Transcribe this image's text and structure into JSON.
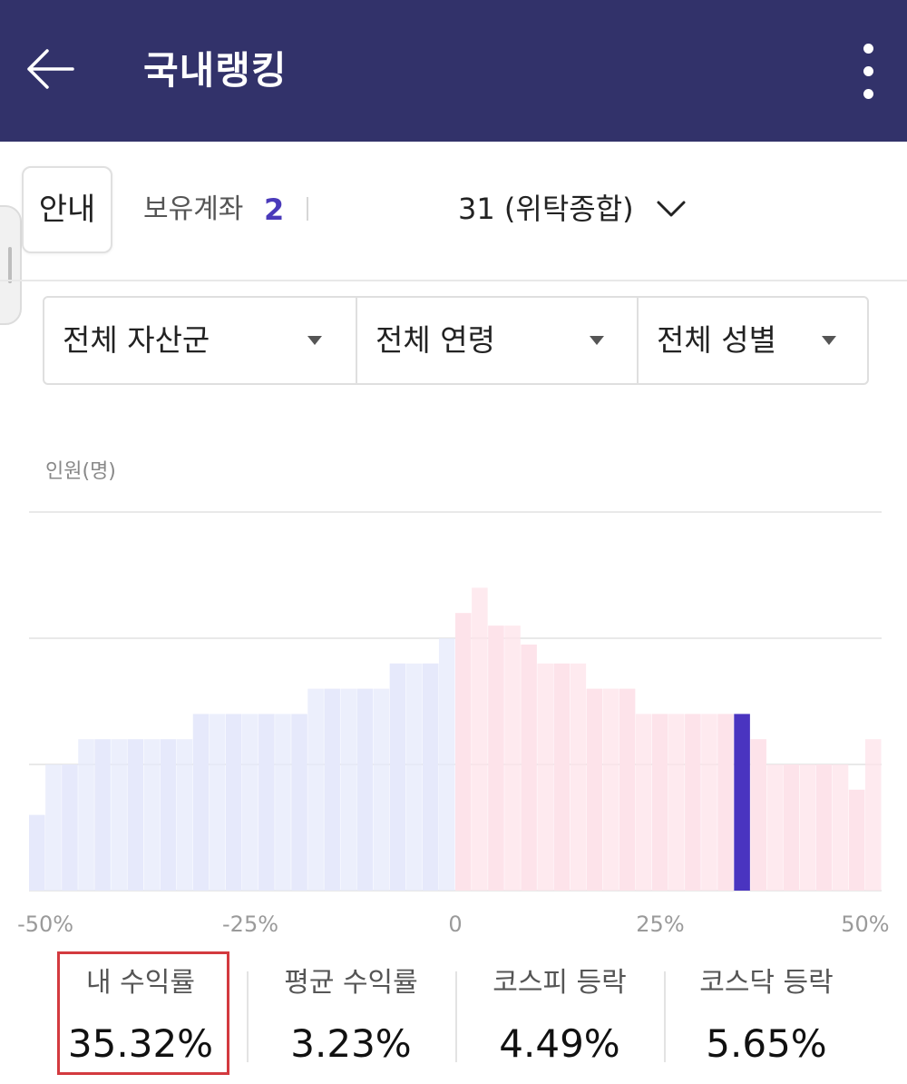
{
  "header": {
    "title": "국내랭킹",
    "back_icon": "arrow-left-icon",
    "more_icon": "more-vertical-icon"
  },
  "info_button": {
    "label": "안내"
  },
  "account": {
    "label": "보유계좌",
    "count": "2",
    "selected": "31 (위탁종합)",
    "dropdown_icon": "chevron-down-icon"
  },
  "filters": [
    {
      "label": "전체 자산군",
      "icon": "caret-down-icon"
    },
    {
      "label": "전체 연령",
      "icon": "caret-down-icon"
    },
    {
      "label": "전체 성별",
      "icon": "caret-down-icon"
    }
  ],
  "chart_data": {
    "type": "bar",
    "ylabel": "인원(명)",
    "xlabel": "",
    "x_ticks": [
      "-50%",
      "-25%",
      "0",
      "25%",
      "50%"
    ],
    "xlim": [
      -52,
      52
    ],
    "ylim": [
      0,
      6
    ],
    "grid": true,
    "bin_width": 2,
    "series": [
      {
        "x": [
          -51,
          -49,
          -47,
          -45,
          -43,
          -41,
          -39,
          -37,
          -35,
          -33,
          -31,
          -29,
          -27,
          -25,
          -23,
          -21,
          -19,
          -17,
          -15,
          -13,
          -11,
          -9,
          -7,
          -5,
          -3,
          -1,
          1,
          3,
          5,
          7,
          9,
          11,
          13,
          15,
          17,
          19,
          21,
          23,
          25,
          27,
          29,
          31,
          33,
          35,
          37,
          39,
          41,
          43,
          45,
          47,
          49,
          51
        ],
        "values": [
          1.2,
          2.0,
          2.0,
          2.4,
          2.4,
          2.4,
          2.4,
          2.4,
          2.4,
          2.4,
          2.8,
          2.8,
          2.8,
          2.8,
          2.8,
          2.8,
          2.8,
          3.2,
          3.2,
          3.2,
          3.2,
          3.2,
          3.6,
          3.6,
          3.6,
          4.0,
          4.4,
          4.8,
          4.2,
          4.2,
          3.9,
          3.6,
          3.6,
          3.6,
          3.2,
          3.2,
          3.2,
          2.8,
          2.8,
          2.8,
          2.8,
          2.8,
          2.8,
          2.8,
          2.4,
          2.0,
          2.0,
          2.0,
          2.0,
          2.0,
          1.6,
          2.4
        ]
      }
    ],
    "highlight": {
      "x": 35,
      "label": "내 수익률"
    },
    "colors": {
      "negative": "#e6e9fb",
      "positive": "#fde3ea",
      "highlight": "#4a34c0",
      "grid": "#e9e9e9"
    }
  },
  "stats": [
    {
      "label": "내 수익률",
      "value": "35.32%",
      "highlighted": true
    },
    {
      "label": "평균 수익률",
      "value": "3.23%"
    },
    {
      "label": "코스피 등락",
      "value": "4.49%"
    },
    {
      "label": "코스닥 등락",
      "value": "5.65%"
    }
  ],
  "colors": {
    "header_bg": "#32326a",
    "accent": "#4a3aba",
    "highlight_border": "#d33a3f"
  }
}
